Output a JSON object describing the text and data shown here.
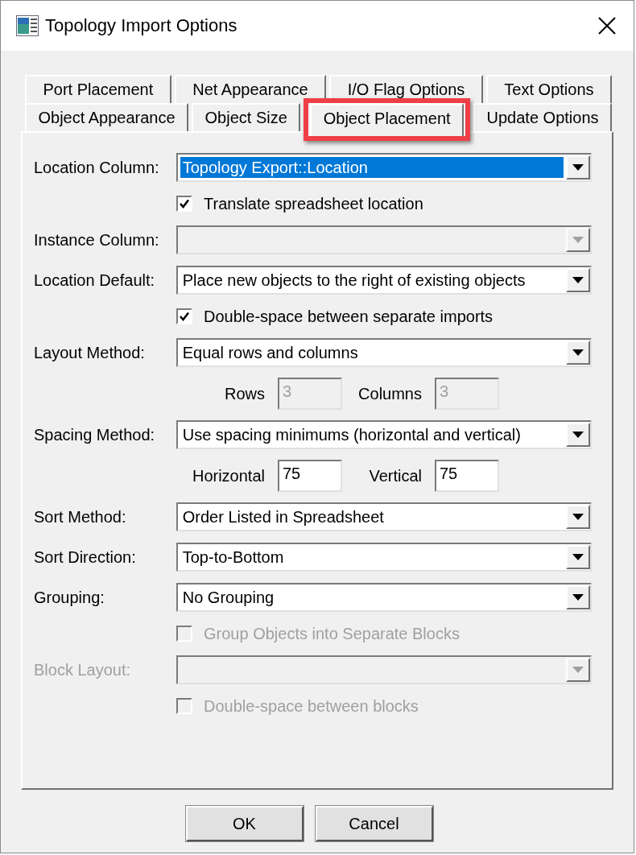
{
  "window": {
    "title": "Topology Import Options"
  },
  "tab_rows": [
    {
      "tabs": [
        {
          "label": "Port Placement",
          "selected": false,
          "annotated": false
        },
        {
          "label": "Net Appearance",
          "selected": false,
          "annotated": false
        },
        {
          "label": "I/O Flag Options",
          "selected": false,
          "annotated": false
        },
        {
          "label": "Text Options",
          "selected": false,
          "annotated": false
        }
      ]
    },
    {
      "tabs": [
        {
          "label": "Object Appearance",
          "selected": false,
          "annotated": false
        },
        {
          "label": "Object Size",
          "selected": false,
          "annotated": false
        },
        {
          "label": "Object Placement",
          "selected": true,
          "annotated": true
        },
        {
          "label": "Update Options",
          "selected": false,
          "annotated": false
        }
      ]
    }
  ],
  "fields": [
    {
      "kind": "combo",
      "label": "Location Column:",
      "value": "Topology Export::Location",
      "value_selected": true,
      "disabled": false
    },
    {
      "kind": "checkbox",
      "label": "Translate spreadsheet location",
      "checked": true,
      "disabled": false
    },
    {
      "kind": "combo",
      "label": "Instance Column:",
      "value_selected": false,
      "disabled": true,
      "label_disabled": false
    },
    {
      "kind": "combo",
      "label": "Location Default:",
      "value": "Place new objects to the right of existing objects",
      "value_selected": false,
      "disabled": false
    },
    {
      "kind": "checkbox",
      "label": "Double-space between separate imports",
      "checked": true,
      "disabled": false
    },
    {
      "kind": "combo",
      "label": "Layout Method:",
      "value": "Equal rows and columns",
      "value_selected": false,
      "disabled": false
    },
    {
      "kind": "pair",
      "items": [
        {
          "label": "Rows",
          "value": "3",
          "disabled": true
        },
        {
          "label": "Columns",
          "value": "3",
          "disabled": true
        }
      ]
    },
    {
      "kind": "combo",
      "label": "Spacing Method:",
      "value": "Use spacing minimums (horizontal and vertical)",
      "value_selected": false,
      "disabled": false
    },
    {
      "kind": "pair",
      "items": [
        {
          "label": "Horizontal",
          "value": "75",
          "disabled": false
        },
        {
          "label": "Vertical",
          "value": "75",
          "disabled": false
        }
      ]
    },
    {
      "kind": "combo",
      "label": "Sort Method:",
      "value": "Order Listed in Spreadsheet",
      "value_selected": false,
      "disabled": false
    },
    {
      "kind": "combo",
      "label": "Sort Direction:",
      "value": "Top-to-Bottom",
      "value_selected": false,
      "disabled": false
    },
    {
      "kind": "combo",
      "label": "Grouping:",
      "value": "No Grouping",
      "value_selected": false,
      "disabled": false
    },
    {
      "kind": "checkbox",
      "label": "Group Objects into Separate Blocks",
      "checked": false,
      "disabled": true
    },
    {
      "kind": "combo",
      "label": "Block Layout:",
      "value_selected": false,
      "disabled": true,
      "label_disabled": true
    },
    {
      "kind": "checkbox",
      "label": "Double-space between blocks",
      "checked": false,
      "disabled": true
    }
  ],
  "buttons": [
    "OK",
    "Cancel"
  ]
}
